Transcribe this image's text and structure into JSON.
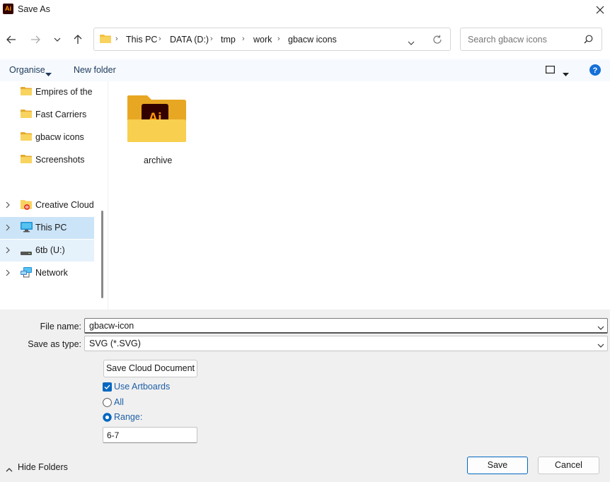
{
  "window": {
    "title": "Save As",
    "app_icon_text": "Ai"
  },
  "address": {
    "crumbs": [
      "This PC",
      "DATA (D:)",
      "tmp",
      "work",
      "gbacw icons"
    ]
  },
  "search": {
    "placeholder": "Search gbacw icons"
  },
  "toolbar": {
    "organise": "Organise",
    "new_folder": "New folder"
  },
  "sidebar": {
    "items": [
      {
        "label": "Empires of the Map",
        "icon": "folder-icon"
      },
      {
        "label": "Fast Carriers",
        "icon": "folder-icon"
      },
      {
        "label": "gbacw icons",
        "icon": "folder-icon"
      },
      {
        "label": "Screenshots",
        "icon": "folder-icon"
      },
      {
        "label": "Creative Cloud Files",
        "icon": "creative-cloud-folder-icon"
      },
      {
        "label": "This PC",
        "icon": "monitor-icon",
        "selected": true
      },
      {
        "label": "6tb (U:)",
        "icon": "drive-icon"
      },
      {
        "label": "Network",
        "icon": "network-icon"
      }
    ]
  },
  "files": [
    {
      "name": "archive",
      "icon": "illustrator-folder-icon"
    }
  ],
  "form": {
    "file_name_label": "File name:",
    "file_name_value": "gbacw-icon",
    "save_type_label": "Save as type:",
    "save_type_value": "SVG (*.SVG)",
    "cloud_button": "Save Cloud Document",
    "use_artboards": "Use Artboards",
    "all_label": "All",
    "range_label": "Range:",
    "range_value": "6-7"
  },
  "footer": {
    "hide_folders": "Hide Folders",
    "save": "Save",
    "cancel": "Cancel"
  },
  "colors": {
    "accent": "#0067c0",
    "folder": "#f3c140",
    "selected_row": "#cce4f7"
  }
}
